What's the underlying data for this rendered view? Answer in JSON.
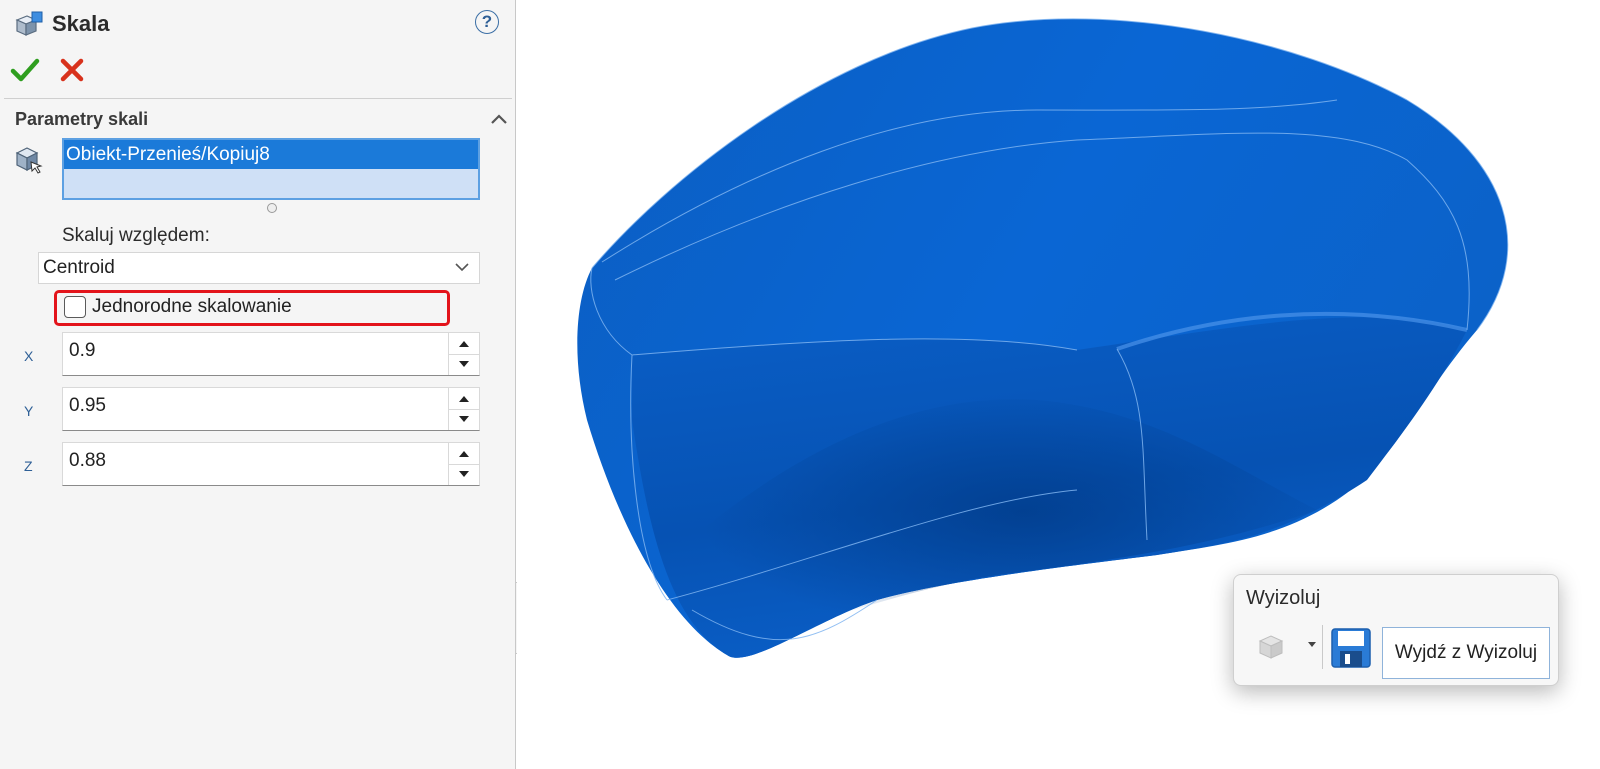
{
  "panel": {
    "title": "Skala",
    "help_label": "?",
    "section_title": "Parametry skali",
    "selection": {
      "items": [
        "Obiekt-Przenieś/Kopiuj8"
      ]
    },
    "scale_about_label": "Skaluj względem:",
    "scale_about_value": "Centroid",
    "uniform_scaling": {
      "label": "Jednorodne skalowanie",
      "checked": false
    },
    "axes": [
      {
        "label": "X",
        "value": "0.9"
      },
      {
        "label": "Y",
        "value": "0.95"
      },
      {
        "label": "Z",
        "value": "0.88"
      }
    ]
  },
  "isolate_popup": {
    "title": "Wyizoluj",
    "exit_label": "Wyjdź z Wyizoluj"
  },
  "colors": {
    "accent": "#1b7ad9",
    "model": "#0a5fc4",
    "highlight": "#e3141b",
    "ok": "#2f9e1f",
    "cancel": "#d8321c"
  },
  "icons": {
    "title": "scale-feature-icon",
    "help": "help-icon",
    "ok": "checkmark-icon",
    "cancel": "close-icon",
    "collapse": "chevron-up-icon",
    "selection": "body-selection-icon",
    "dropdown": "chevron-down-icon",
    "isolate_display": "display-style-icon",
    "isolate_save": "save-icon"
  }
}
